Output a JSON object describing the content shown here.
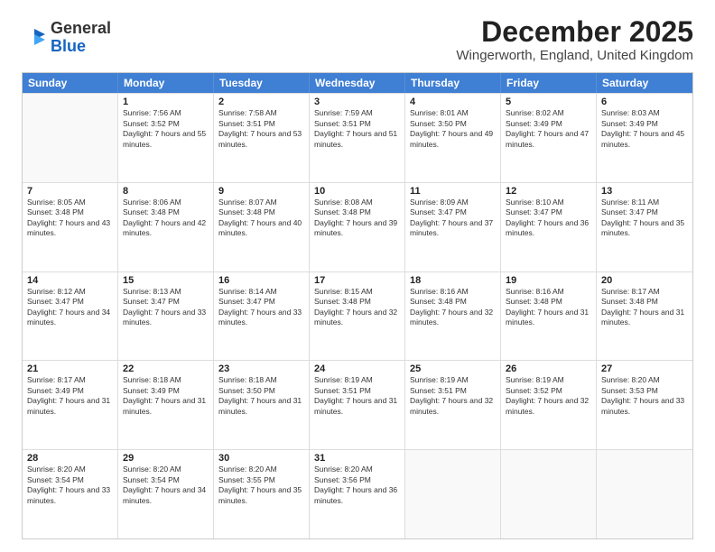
{
  "header": {
    "logo_general": "General",
    "logo_blue": "Blue",
    "title": "December 2025",
    "subtitle": "Wingerworth, England, United Kingdom"
  },
  "days_of_week": [
    "Sunday",
    "Monday",
    "Tuesday",
    "Wednesday",
    "Thursday",
    "Friday",
    "Saturday"
  ],
  "weeks": [
    [
      {
        "day": "",
        "sunrise": "",
        "sunset": "",
        "daylight": ""
      },
      {
        "day": "1",
        "sunrise": "Sunrise: 7:56 AM",
        "sunset": "Sunset: 3:52 PM",
        "daylight": "Daylight: 7 hours and 55 minutes."
      },
      {
        "day": "2",
        "sunrise": "Sunrise: 7:58 AM",
        "sunset": "Sunset: 3:51 PM",
        "daylight": "Daylight: 7 hours and 53 minutes."
      },
      {
        "day": "3",
        "sunrise": "Sunrise: 7:59 AM",
        "sunset": "Sunset: 3:51 PM",
        "daylight": "Daylight: 7 hours and 51 minutes."
      },
      {
        "day": "4",
        "sunrise": "Sunrise: 8:01 AM",
        "sunset": "Sunset: 3:50 PM",
        "daylight": "Daylight: 7 hours and 49 minutes."
      },
      {
        "day": "5",
        "sunrise": "Sunrise: 8:02 AM",
        "sunset": "Sunset: 3:49 PM",
        "daylight": "Daylight: 7 hours and 47 minutes."
      },
      {
        "day": "6",
        "sunrise": "Sunrise: 8:03 AM",
        "sunset": "Sunset: 3:49 PM",
        "daylight": "Daylight: 7 hours and 45 minutes."
      }
    ],
    [
      {
        "day": "7",
        "sunrise": "Sunrise: 8:05 AM",
        "sunset": "Sunset: 3:48 PM",
        "daylight": "Daylight: 7 hours and 43 minutes."
      },
      {
        "day": "8",
        "sunrise": "Sunrise: 8:06 AM",
        "sunset": "Sunset: 3:48 PM",
        "daylight": "Daylight: 7 hours and 42 minutes."
      },
      {
        "day": "9",
        "sunrise": "Sunrise: 8:07 AM",
        "sunset": "Sunset: 3:48 PM",
        "daylight": "Daylight: 7 hours and 40 minutes."
      },
      {
        "day": "10",
        "sunrise": "Sunrise: 8:08 AM",
        "sunset": "Sunset: 3:48 PM",
        "daylight": "Daylight: 7 hours and 39 minutes."
      },
      {
        "day": "11",
        "sunrise": "Sunrise: 8:09 AM",
        "sunset": "Sunset: 3:47 PM",
        "daylight": "Daylight: 7 hours and 37 minutes."
      },
      {
        "day": "12",
        "sunrise": "Sunrise: 8:10 AM",
        "sunset": "Sunset: 3:47 PM",
        "daylight": "Daylight: 7 hours and 36 minutes."
      },
      {
        "day": "13",
        "sunrise": "Sunrise: 8:11 AM",
        "sunset": "Sunset: 3:47 PM",
        "daylight": "Daylight: 7 hours and 35 minutes."
      }
    ],
    [
      {
        "day": "14",
        "sunrise": "Sunrise: 8:12 AM",
        "sunset": "Sunset: 3:47 PM",
        "daylight": "Daylight: 7 hours and 34 minutes."
      },
      {
        "day": "15",
        "sunrise": "Sunrise: 8:13 AM",
        "sunset": "Sunset: 3:47 PM",
        "daylight": "Daylight: 7 hours and 33 minutes."
      },
      {
        "day": "16",
        "sunrise": "Sunrise: 8:14 AM",
        "sunset": "Sunset: 3:47 PM",
        "daylight": "Daylight: 7 hours and 33 minutes."
      },
      {
        "day": "17",
        "sunrise": "Sunrise: 8:15 AM",
        "sunset": "Sunset: 3:48 PM",
        "daylight": "Daylight: 7 hours and 32 minutes."
      },
      {
        "day": "18",
        "sunrise": "Sunrise: 8:16 AM",
        "sunset": "Sunset: 3:48 PM",
        "daylight": "Daylight: 7 hours and 32 minutes."
      },
      {
        "day": "19",
        "sunrise": "Sunrise: 8:16 AM",
        "sunset": "Sunset: 3:48 PM",
        "daylight": "Daylight: 7 hours and 31 minutes."
      },
      {
        "day": "20",
        "sunrise": "Sunrise: 8:17 AM",
        "sunset": "Sunset: 3:48 PM",
        "daylight": "Daylight: 7 hours and 31 minutes."
      }
    ],
    [
      {
        "day": "21",
        "sunrise": "Sunrise: 8:17 AM",
        "sunset": "Sunset: 3:49 PM",
        "daylight": "Daylight: 7 hours and 31 minutes."
      },
      {
        "day": "22",
        "sunrise": "Sunrise: 8:18 AM",
        "sunset": "Sunset: 3:49 PM",
        "daylight": "Daylight: 7 hours and 31 minutes."
      },
      {
        "day": "23",
        "sunrise": "Sunrise: 8:18 AM",
        "sunset": "Sunset: 3:50 PM",
        "daylight": "Daylight: 7 hours and 31 minutes."
      },
      {
        "day": "24",
        "sunrise": "Sunrise: 8:19 AM",
        "sunset": "Sunset: 3:51 PM",
        "daylight": "Daylight: 7 hours and 31 minutes."
      },
      {
        "day": "25",
        "sunrise": "Sunrise: 8:19 AM",
        "sunset": "Sunset: 3:51 PM",
        "daylight": "Daylight: 7 hours and 32 minutes."
      },
      {
        "day": "26",
        "sunrise": "Sunrise: 8:19 AM",
        "sunset": "Sunset: 3:52 PM",
        "daylight": "Daylight: 7 hours and 32 minutes."
      },
      {
        "day": "27",
        "sunrise": "Sunrise: 8:20 AM",
        "sunset": "Sunset: 3:53 PM",
        "daylight": "Daylight: 7 hours and 33 minutes."
      }
    ],
    [
      {
        "day": "28",
        "sunrise": "Sunrise: 8:20 AM",
        "sunset": "Sunset: 3:54 PM",
        "daylight": "Daylight: 7 hours and 33 minutes."
      },
      {
        "day": "29",
        "sunrise": "Sunrise: 8:20 AM",
        "sunset": "Sunset: 3:54 PM",
        "daylight": "Daylight: 7 hours and 34 minutes."
      },
      {
        "day": "30",
        "sunrise": "Sunrise: 8:20 AM",
        "sunset": "Sunset: 3:55 PM",
        "daylight": "Daylight: 7 hours and 35 minutes."
      },
      {
        "day": "31",
        "sunrise": "Sunrise: 8:20 AM",
        "sunset": "Sunset: 3:56 PM",
        "daylight": "Daylight: 7 hours and 36 minutes."
      },
      {
        "day": "",
        "sunrise": "",
        "sunset": "",
        "daylight": ""
      },
      {
        "day": "",
        "sunrise": "",
        "sunset": "",
        "daylight": ""
      },
      {
        "day": "",
        "sunrise": "",
        "sunset": "",
        "daylight": ""
      }
    ]
  ]
}
